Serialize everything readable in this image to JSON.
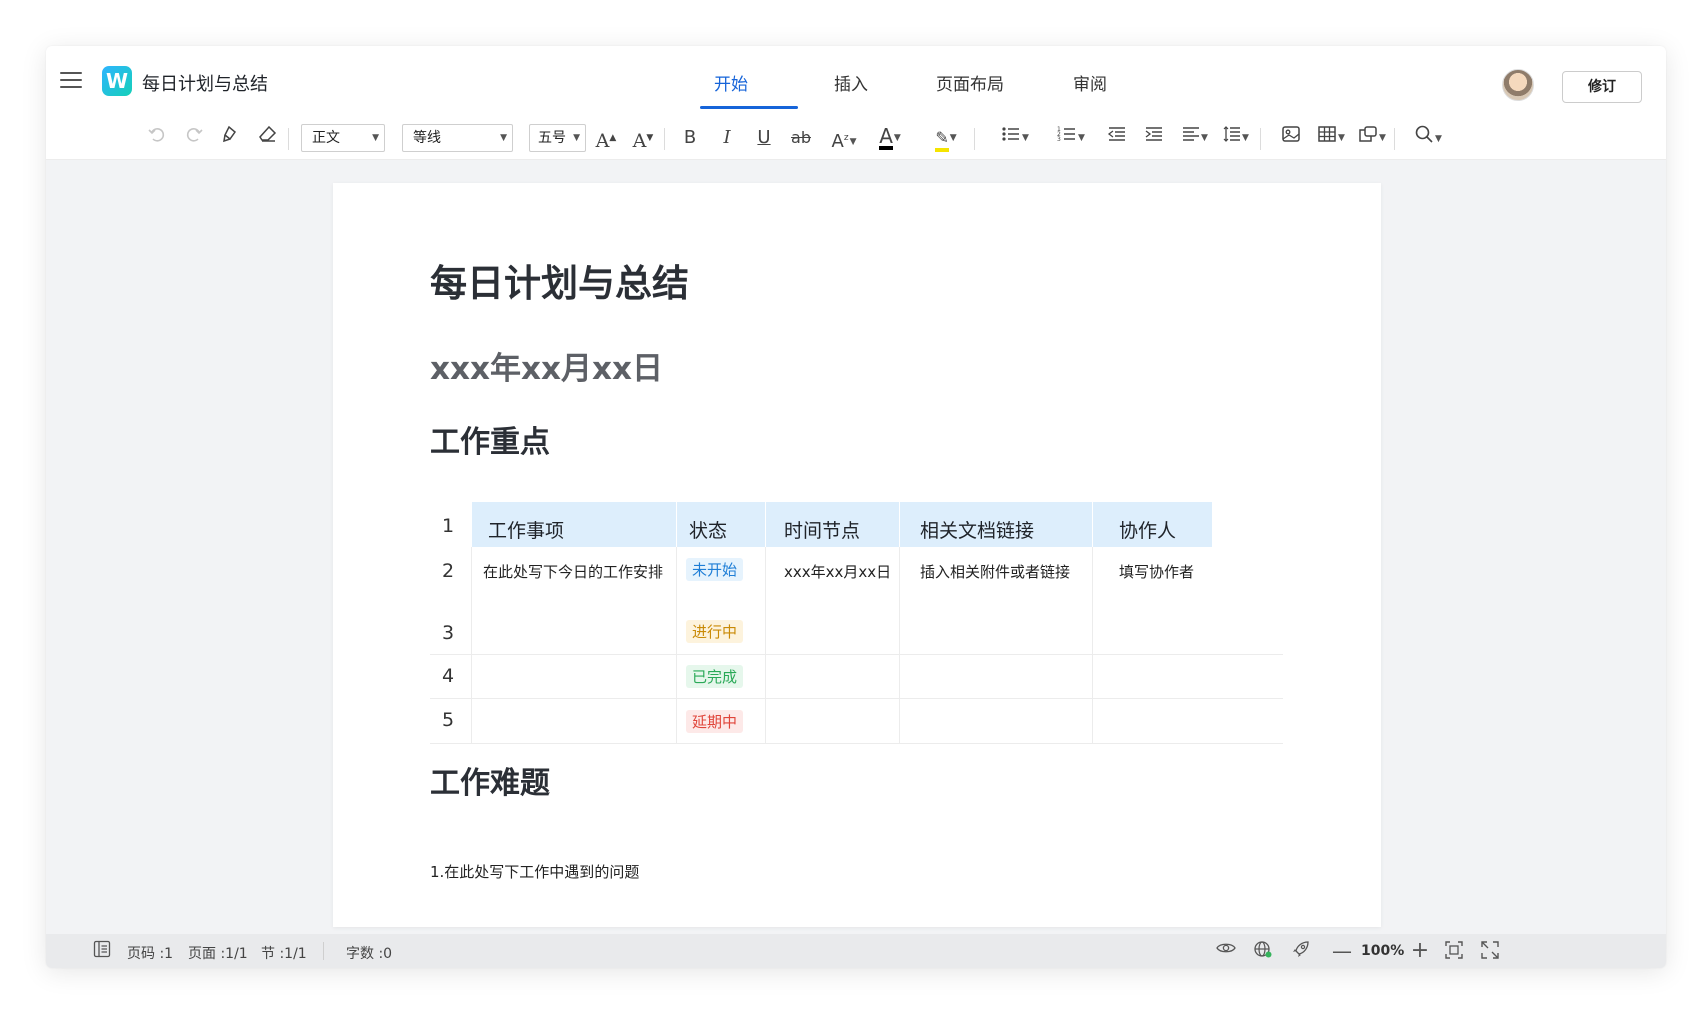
{
  "app": {
    "doc_title": "每日计划与总结",
    "logo_letter": "W",
    "accent_color": "#1664d9"
  },
  "tabs": [
    {
      "label": "开始",
      "active": true
    },
    {
      "label": "插入",
      "active": false
    },
    {
      "label": "页面布局",
      "active": false
    },
    {
      "label": "审阅",
      "active": false
    }
  ],
  "header": {
    "revise_button": "修订",
    "avatar": "user-avatar"
  },
  "toolbar": {
    "style_select": "正文",
    "font_select": "等线",
    "size_select": "五号",
    "icons": [
      "undo-icon",
      "redo-icon",
      "format-painter-icon",
      "eraser-icon",
      "font-increase-icon",
      "font-decrease-icon",
      "bold-icon",
      "italic-icon",
      "underline-icon",
      "strikethrough-icon",
      "superscript-icon",
      "font-color-icon",
      "highlight-icon",
      "bullet-list-icon",
      "numbered-list-icon",
      "outdent-icon",
      "indent-icon",
      "align-icon",
      "line-spacing-icon",
      "image-icon",
      "table-icon",
      "shape-icon",
      "search-icon"
    ],
    "font_color": "#000000",
    "highlight_color": "#f5e400"
  },
  "document": {
    "title": "每日计划与总结",
    "date": "xxx年xx月xx日",
    "section1": "工作重点",
    "section2": "工作难题",
    "paragraph": "1.在此处写下工作中遇到的问题",
    "table": {
      "headers": [
        "工作事项",
        "状态",
        "时间节点",
        "相关文档链接",
        "协作人"
      ],
      "row_numbers": [
        "1",
        "2",
        "3",
        "4",
        "5"
      ],
      "rows": [
        {
          "task": "在此处写下今日的工作安排",
          "status": "未开始",
          "time": "xxx年xx月xx日",
          "link": "插入相关附件或者链接",
          "collab": "填写协作者"
        },
        {
          "task": "",
          "status": "进行中",
          "time": "",
          "link": "",
          "collab": ""
        },
        {
          "task": "",
          "status": "已完成",
          "time": "",
          "link": "",
          "collab": ""
        },
        {
          "task": "",
          "status": "延期中",
          "time": "",
          "link": "",
          "collab": ""
        }
      ],
      "status_colors": {
        "未开始": {
          "fg": "#1f7ed6",
          "bg": "#e6f3fd"
        },
        "进行中": {
          "fg": "#c98a06",
          "bg": "#fdf3dd"
        },
        "已完成": {
          "fg": "#2aa957",
          "bg": "#e6f7ec"
        },
        "延期中": {
          "fg": "#e0453a",
          "bg": "#fde9e8"
        }
      },
      "header_bg": "#ddeefc"
    }
  },
  "statusbar": {
    "page_code": "页码 :1",
    "pages": "页面 :1/1",
    "section": "节 :1/1",
    "word_count": "字数 :0",
    "zoom": "100%"
  }
}
